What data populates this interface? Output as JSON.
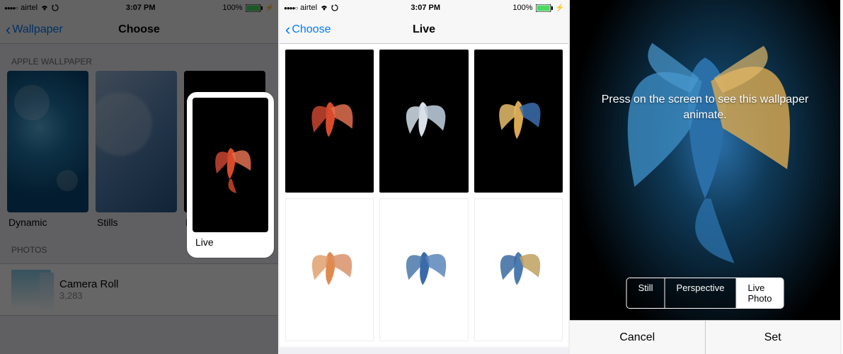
{
  "status": {
    "carrier": "airtel",
    "time": "3:07 PM",
    "battery": "100%"
  },
  "screen1": {
    "back_label": "Wallpaper",
    "title": "Choose",
    "section1": "APPLE WALLPAPER",
    "thumb1": "Dynamic",
    "thumb2": "Stills",
    "thumb3": "Live",
    "section2": "PHOTOS",
    "album": {
      "title": "Camera Roll",
      "count": "3,283"
    }
  },
  "screen2": {
    "back_label": "Choose",
    "title": "Live"
  },
  "screen3": {
    "hint": "Press on the screen to see this wallpaper animate.",
    "seg": {
      "still": "Still",
      "perspective": "Perspective",
      "live": "Live Photo"
    },
    "cancel": "Cancel",
    "set": "Set"
  },
  "fish_colors": {
    "red": {
      "body": "#d84a2a",
      "tail": "#e07050"
    },
    "whiteblue": {
      "body": "#d9e0e8",
      "tail": "#a8bccc"
    },
    "goldblue": {
      "body": "#d9a850",
      "tail": "#3a6aaa"
    },
    "orange": {
      "body": "#e08a50",
      "tail": "#d9926a"
    },
    "blue": {
      "body": "#3a6aaa",
      "tail": "#5a86b8"
    },
    "bluegold": {
      "body": "#4a7ab0",
      "tail": "#c0a060"
    }
  }
}
